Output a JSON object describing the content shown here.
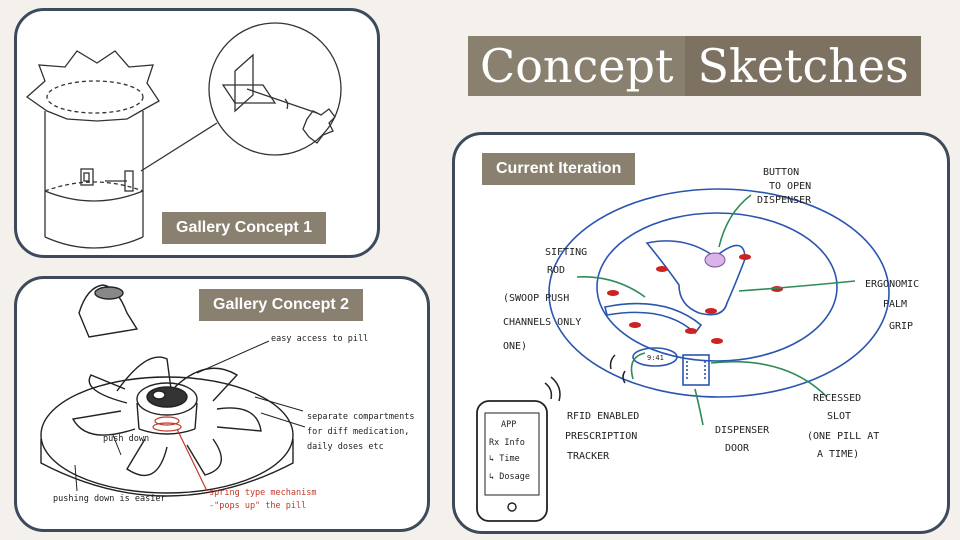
{
  "slide": {
    "title_word_1": "Concept",
    "title_word_2": "Sketches"
  },
  "gallery_1": {
    "label": "Gallery Concept 1"
  },
  "gallery_2": {
    "label": "Gallery Concept 2",
    "notes": {
      "easy_access": "easy access to pill",
      "separate_1": "separate compartments",
      "separate_2": "for diff medication,",
      "separate_3": "daily doses etc",
      "push_down": "push down",
      "pushing_easier": "pushing down is easier",
      "spring_1": "spring type mechanism",
      "spring_2": "-\"pops up\" the pill"
    },
    "annotation_color": "#c0392b"
  },
  "current": {
    "label": "Current Iteration",
    "labels": {
      "button_1": "BUTTON",
      "button_2": "TO OPEN",
      "button_3": "DISPENSER",
      "sifting_1": "SIFTING",
      "sifting_2": "ROD",
      "swoop_1": "(SWOOP PUSH",
      "swoop_2": "CHANNELS ONLY",
      "swoop_3": "ONE)",
      "ergo_1": "ERGONOMIC",
      "ergo_2": "PALM",
      "ergo_3": "GRIP",
      "rfid_1": "RFID ENABLED",
      "rfid_2": "PRESCRIPTION",
      "rfid_3": "TRACKER",
      "door_1": "DISPENSER",
      "door_2": "DOOR",
      "slot_1": "RECESSED",
      "slot_2": "SLOT",
      "slot_3": "(ONE PILL AT",
      "slot_4": "A TIME)",
      "display": "9:41"
    },
    "phone": {
      "line_1": "APP",
      "line_2": "Rx Info",
      "line_3": "↳ Time",
      "line_4": "↳ Dosage"
    },
    "arrow_color": "#2e8b57",
    "outline_color": "#2a55b0",
    "pill_color": "#cc2222",
    "button_color": "#d8b4e8"
  }
}
